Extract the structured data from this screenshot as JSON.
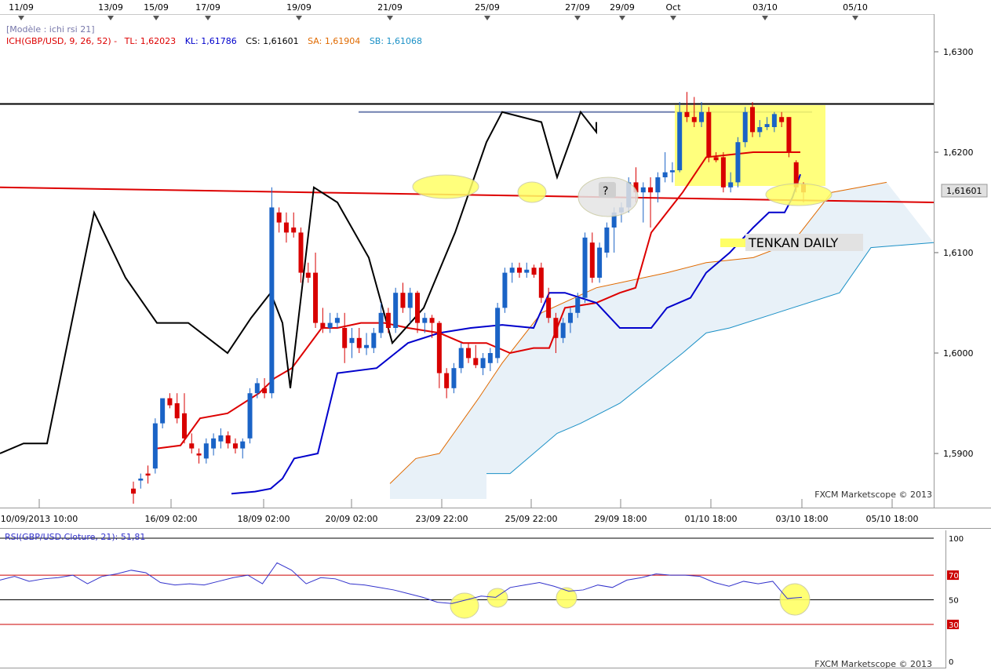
{
  "top_dates": [
    "11/09",
    "13/09",
    "15/09",
    "17/09",
    "19/09",
    "21/09",
    "25/09",
    "27/09",
    "29/09",
    "Oct",
    "03/10",
    "05/10"
  ],
  "legend": {
    "model": "[Modèle : ichi rsi 21]",
    "ich_prefix": "ICH(GBP/USD, 9, 26, 52) -",
    "tl": "TL: 1,62023",
    "kl": "KL: 1,61786",
    "cs": "CS: 1,61601",
    "sa": "SA: 1,61904",
    "sb": "SB: 1,61068"
  },
  "price_axis": [
    "1,6300",
    "1,6200",
    "1,6100",
    "1,6000",
    "1,5900"
  ],
  "last_price": "1,61601",
  "time_axis": [
    "10/09/2013 10:00",
    "16/09 02:00",
    "18/09 02:00",
    "20/09 02:00",
    "23/09 22:00",
    "25/09 22:00",
    "29/09 18:00",
    "01/10 18:00",
    "03/10 18:00",
    "05/10 18:00"
  ],
  "watermark": "FXCM Marketscope © 2013",
  "annotation_question": "?",
  "annotation_tenkan": "TENKAN DAILY",
  "rsi_title": "RSI(GBP/USD.Cloture, 21): 51,81",
  "rsi_axis": [
    "100",
    "70",
    "50",
    "30",
    "0"
  ],
  "colors": {
    "tenkan": "#dd0000",
    "kijun": "#0000cc",
    "chikou": "#000000",
    "cloud": "#e8f1f8",
    "bull": "#1a63c6",
    "bear": "#d80000",
    "highlight": "#ffff66"
  },
  "chart_data": [
    {
      "type": "candlestick",
      "title": "ICH(GBP/USD, 9, 26, 52)",
      "ylim": [
        1.585,
        1.6345
      ],
      "series": [
        {
          "name": "TL",
          "values": [
            1.5905,
            1.5908,
            1.5935,
            1.594,
            1.596,
            1.5975,
            1.5985,
            1.6025,
            1.6025,
            1.603,
            1.603,
            1.6025,
            1.602,
            1.601,
            1.601,
            1.6,
            1.6005,
            1.6005,
            1.6045,
            1.605,
            1.606,
            1.6065,
            1.612,
            1.614,
            1.616,
            1.6195,
            1.62,
            1.62
          ]
        },
        {
          "name": "KL",
          "values": [
            1.586,
            1.5862,
            1.5865,
            1.5875,
            1.5895,
            1.59,
            1.598,
            1.5985,
            1.601,
            1.602,
            1.6025,
            1.6028,
            1.6025,
            1.606,
            1.606,
            1.605,
            1.6025,
            1.6025,
            1.6025,
            1.6045,
            1.6055,
            1.608,
            1.61,
            1.6125,
            1.614,
            1.614,
            1.6155,
            1.6178
          ]
        },
        {
          "name": "CS",
          "values": [
            1.59,
            1.591,
            1.591,
            1.614,
            1.6075,
            1.603,
            1.603,
            1.6,
            1.6035,
            1.606,
            1.603,
            1.5965,
            1.6165,
            1.615,
            1.6095,
            1.601,
            1.6045,
            1.612,
            1.621,
            1.624,
            1.623,
            1.6175,
            1.624,
            1.622,
            1.623
          ]
        },
        {
          "name": "SA",
          "values": [
            1.587,
            1.5895,
            1.59,
            1.5955,
            1.599,
            1.604,
            1.6065,
            1.608,
            1.609,
            1.6095,
            1.611,
            1.616,
            1.617
          ]
        },
        {
          "name": "SB",
          "values": [
            1.588,
            1.588,
            1.592,
            1.593,
            1.595,
            1.6,
            1.602,
            1.6025,
            1.604,
            1.606,
            1.6105,
            1.611
          ]
        }
      ],
      "candles": [
        {
          "o": 1.5865,
          "h": 1.5872,
          "l": 1.585,
          "c": 1.586
        },
        {
          "o": 1.5873,
          "h": 1.588,
          "l": 1.5865,
          "c": 1.5875
        },
        {
          "o": 1.588,
          "h": 1.5888,
          "l": 1.587,
          "c": 1.5878
        },
        {
          "o": 1.5885,
          "h": 1.5935,
          "l": 1.588,
          "c": 1.593
        },
        {
          "o": 1.593,
          "h": 1.595,
          "l": 1.5925,
          "c": 1.5955
        },
        {
          "o": 1.5955,
          "h": 1.596,
          "l": 1.5945,
          "c": 1.5948
        },
        {
          "o": 1.595,
          "h": 1.596,
          "l": 1.593,
          "c": 1.5935
        },
        {
          "o": 1.594,
          "h": 1.596,
          "l": 1.591,
          "c": 1.5915
        },
        {
          "o": 1.591,
          "h": 1.592,
          "l": 1.59,
          "c": 1.5905
        },
        {
          "o": 1.59,
          "h": 1.5905,
          "l": 1.589,
          "c": 1.5898
        },
        {
          "o": 1.5895,
          "h": 1.5915,
          "l": 1.589,
          "c": 1.591
        },
        {
          "o": 1.5905,
          "h": 1.592,
          "l": 1.5898,
          "c": 1.5915
        },
        {
          "o": 1.5912,
          "h": 1.5925,
          "l": 1.5905,
          "c": 1.5918
        },
        {
          "o": 1.5918,
          "h": 1.5922,
          "l": 1.5905,
          "c": 1.591
        },
        {
          "o": 1.591,
          "h": 1.5915,
          "l": 1.59,
          "c": 1.5905
        },
        {
          "o": 1.5905,
          "h": 1.5915,
          "l": 1.5895,
          "c": 1.5912
        },
        {
          "o": 1.5915,
          "h": 1.5965,
          "l": 1.591,
          "c": 1.596
        },
        {
          "o": 1.596,
          "h": 1.5975,
          "l": 1.5955,
          "c": 1.597
        },
        {
          "o": 1.5965,
          "h": 1.5975,
          "l": 1.5955,
          "c": 1.596
        },
        {
          "o": 1.596,
          "h": 1.6165,
          "l": 1.5955,
          "c": 1.6145
        },
        {
          "o": 1.614,
          "h": 1.6145,
          "l": 1.612,
          "c": 1.613
        },
        {
          "o": 1.613,
          "h": 1.614,
          "l": 1.611,
          "c": 1.612
        },
        {
          "o": 1.6125,
          "h": 1.614,
          "l": 1.6115,
          "c": 1.612
        },
        {
          "o": 1.612,
          "h": 1.6125,
          "l": 1.607,
          "c": 1.608
        },
        {
          "o": 1.608,
          "h": 1.609,
          "l": 1.607,
          "c": 1.6075
        },
        {
          "o": 1.608,
          "h": 1.61,
          "l": 1.6025,
          "c": 1.603
        },
        {
          "o": 1.603,
          "h": 1.6045,
          "l": 1.602,
          "c": 1.6025
        },
        {
          "o": 1.6025,
          "h": 1.604,
          "l": 1.602,
          "c": 1.603
        },
        {
          "o": 1.603,
          "h": 1.604,
          "l": 1.6025,
          "c": 1.6035
        },
        {
          "o": 1.6025,
          "h": 1.604,
          "l": 1.599,
          "c": 1.6005
        },
        {
          "o": 1.601,
          "h": 1.6025,
          "l": 1.5995,
          "c": 1.6015
        },
        {
          "o": 1.6015,
          "h": 1.6025,
          "l": 1.6,
          "c": 1.6005
        },
        {
          "o": 1.6005,
          "h": 1.602,
          "l": 1.5998,
          "c": 1.6008
        },
        {
          "o": 1.6005,
          "h": 1.6025,
          "l": 1.6,
          "c": 1.602
        },
        {
          "o": 1.602,
          "h": 1.605,
          "l": 1.6015,
          "c": 1.604
        },
        {
          "o": 1.604,
          "h": 1.6045,
          "l": 1.602,
          "c": 1.6025
        },
        {
          "o": 1.6025,
          "h": 1.6065,
          "l": 1.602,
          "c": 1.606
        },
        {
          "o": 1.606,
          "h": 1.607,
          "l": 1.604,
          "c": 1.6045
        },
        {
          "o": 1.6045,
          "h": 1.6065,
          "l": 1.603,
          "c": 1.606
        },
        {
          "o": 1.606,
          "h": 1.6062,
          "l": 1.602,
          "c": 1.603
        },
        {
          "o": 1.603,
          "h": 1.604,
          "l": 1.602,
          "c": 1.6035
        },
        {
          "o": 1.6035,
          "h": 1.6038,
          "l": 1.6015,
          "c": 1.603
        },
        {
          "o": 1.603,
          "h": 1.6032,
          "l": 1.5965,
          "c": 1.598
        },
        {
          "o": 1.598,
          "h": 1.5985,
          "l": 1.5955,
          "c": 1.5965
        },
        {
          "o": 1.5965,
          "h": 1.599,
          "l": 1.596,
          "c": 1.5985
        },
        {
          "o": 1.5985,
          "h": 1.601,
          "l": 1.598,
          "c": 1.6005
        },
        {
          "o": 1.6005,
          "h": 1.601,
          "l": 1.599,
          "c": 1.5995
        },
        {
          "o": 1.5995,
          "h": 1.6008,
          "l": 1.5985,
          "c": 1.5988
        },
        {
          "o": 1.5985,
          "h": 1.6,
          "l": 1.5978,
          "c": 1.5995
        },
        {
          "o": 1.599,
          "h": 1.6005,
          "l": 1.5982,
          "c": 1.6
        },
        {
          "o": 1.5995,
          "h": 1.605,
          "l": 1.599,
          "c": 1.6045
        },
        {
          "o": 1.6045,
          "h": 1.6085,
          "l": 1.604,
          "c": 1.608
        },
        {
          "o": 1.608,
          "h": 1.609,
          "l": 1.607,
          "c": 1.6085
        },
        {
          "o": 1.6085,
          "h": 1.609,
          "l": 1.6075,
          "c": 1.608
        },
        {
          "o": 1.608,
          "h": 1.609,
          "l": 1.6075,
          "c": 1.6083
        },
        {
          "o": 1.6085,
          "h": 1.6088,
          "l": 1.6075,
          "c": 1.6078
        },
        {
          "o": 1.6085,
          "h": 1.609,
          "l": 1.605,
          "c": 1.6055
        },
        {
          "o": 1.6055,
          "h": 1.6065,
          "l": 1.603,
          "c": 1.6035
        },
        {
          "o": 1.6035,
          "h": 1.604,
          "l": 1.6,
          "c": 1.6015
        },
        {
          "o": 1.6015,
          "h": 1.6035,
          "l": 1.601,
          "c": 1.603
        },
        {
          "o": 1.603,
          "h": 1.6045,
          "l": 1.602,
          "c": 1.604
        },
        {
          "o": 1.604,
          "h": 1.606,
          "l": 1.6035,
          "c": 1.6055
        },
        {
          "o": 1.6055,
          "h": 1.612,
          "l": 1.605,
          "c": 1.6115
        },
        {
          "o": 1.611,
          "h": 1.612,
          "l": 1.607,
          "c": 1.6075
        },
        {
          "o": 1.6075,
          "h": 1.611,
          "l": 1.607,
          "c": 1.6105
        },
        {
          "o": 1.61,
          "h": 1.613,
          "l": 1.6095,
          "c": 1.6125
        },
        {
          "o": 1.6125,
          "h": 1.6145,
          "l": 1.61,
          "c": 1.614
        },
        {
          "o": 1.614,
          "h": 1.615,
          "l": 1.613,
          "c": 1.6145
        },
        {
          "o": 1.6145,
          "h": 1.6175,
          "l": 1.614,
          "c": 1.617
        },
        {
          "o": 1.617,
          "h": 1.6185,
          "l": 1.615,
          "c": 1.616
        },
        {
          "o": 1.616,
          "h": 1.617,
          "l": 1.613,
          "c": 1.6165
        },
        {
          "o": 1.6165,
          "h": 1.6175,
          "l": 1.6125,
          "c": 1.616
        },
        {
          "o": 1.616,
          "h": 1.618,
          "l": 1.615,
          "c": 1.6175
        },
        {
          "o": 1.6175,
          "h": 1.62,
          "l": 1.617,
          "c": 1.618
        },
        {
          "o": 1.618,
          "h": 1.619,
          "l": 1.617,
          "c": 1.6182
        },
        {
          "o": 1.6182,
          "h": 1.625,
          "l": 1.618,
          "c": 1.624
        },
        {
          "o": 1.624,
          "h": 1.626,
          "l": 1.623,
          "c": 1.6235
        },
        {
          "o": 1.6235,
          "h": 1.6255,
          "l": 1.6225,
          "c": 1.623
        },
        {
          "o": 1.623,
          "h": 1.625,
          "l": 1.6225,
          "c": 1.624
        },
        {
          "o": 1.624,
          "h": 1.6245,
          "l": 1.619,
          "c": 1.6195
        },
        {
          "o": 1.6195,
          "h": 1.62,
          "l": 1.619,
          "c": 1.6192
        },
        {
          "o": 1.6195,
          "h": 1.62,
          "l": 1.616,
          "c": 1.6165
        },
        {
          "o": 1.6165,
          "h": 1.618,
          "l": 1.616,
          "c": 1.617
        },
        {
          "o": 1.617,
          "h": 1.6215,
          "l": 1.6165,
          "c": 1.621
        },
        {
          "o": 1.621,
          "h": 1.6245,
          "l": 1.6205,
          "c": 1.624
        },
        {
          "o": 1.6245,
          "h": 1.625,
          "l": 1.6215,
          "c": 1.622
        },
        {
          "o": 1.622,
          "h": 1.6232,
          "l": 1.6215,
          "c": 1.6225
        },
        {
          "o": 1.6225,
          "h": 1.6235,
          "l": 1.6222,
          "c": 1.6228
        },
        {
          "o": 1.6225,
          "h": 1.624,
          "l": 1.622,
          "c": 1.6238
        },
        {
          "o": 1.6235,
          "h": 1.624,
          "l": 1.6225,
          "c": 1.623
        },
        {
          "o": 1.6235,
          "h": 1.6235,
          "l": 1.6195,
          "c": 1.62
        },
        {
          "o": 1.619,
          "h": 1.6192,
          "l": 1.616,
          "c": 1.6165
        },
        {
          "o": 1.6168,
          "h": 1.617,
          "l": 1.615,
          "c": 1.616
        }
      ],
      "hlines": [
        1.6248,
        1.624
      ],
      "support_line": [
        1.6165,
        1.615
      ]
    },
    {
      "type": "line",
      "title": "RSI(GBP/USD.Cloture, 21): 51,81",
      "ylim": [
        0,
        100
      ],
      "levels": [
        100,
        70,
        50,
        30
      ],
      "series": [
        {
          "name": "RSI",
          "values": [
            66,
            69,
            65,
            67,
            68,
            70,
            63,
            69,
            71,
            74,
            72,
            64,
            62,
            63,
            62,
            65,
            68,
            70,
            63,
            80,
            74,
            63,
            68,
            67,
            63,
            62,
            60,
            58,
            55,
            52,
            48,
            47,
            50,
            53,
            52,
            60,
            62,
            64,
            61,
            57,
            58,
            62,
            60,
            66,
            68,
            71,
            70,
            70,
            69,
            64,
            61,
            65,
            63,
            65,
            51,
            52
          ]
        }
      ]
    }
  ]
}
